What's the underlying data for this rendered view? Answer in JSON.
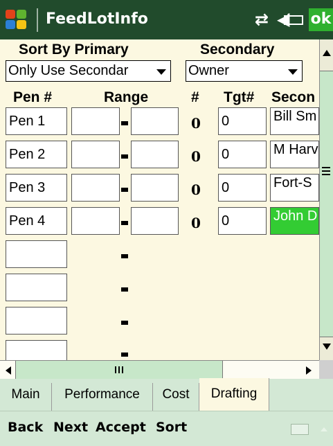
{
  "window": {
    "title": "FeedLotInfo",
    "ok_label": "ok"
  },
  "header": {
    "sort_primary_label": "Sort By Primary",
    "secondary_label": "Secondary"
  },
  "selects": {
    "primary_value": "Only Use Secondar",
    "secondary_value": "Owner"
  },
  "columns": {
    "pen": "Pen #",
    "range": "Range",
    "count": "#",
    "target": "Tgt#",
    "secondary": "Secon"
  },
  "rows": [
    {
      "pen": "Pen 1",
      "count": "0",
      "target": "0",
      "secondary": "Bill Sm"
    },
    {
      "pen": "Pen 2",
      "count": "0",
      "target": "0",
      "secondary": "M Harv"
    },
    {
      "pen": "Pen 3",
      "count": "0",
      "target": "0",
      "secondary": "Fort-S"
    },
    {
      "pen": "Pen 4",
      "count": "0",
      "target": "0",
      "secondary": "John D"
    }
  ],
  "tabs": [
    "Main",
    "Performance",
    "Cost",
    "Drafting"
  ],
  "active_tab": "Drafting",
  "softkeys": [
    "Back",
    "Next",
    "Accept",
    "Sort"
  ],
  "colors": {
    "titlebar": "#214b2c",
    "content_bg": "#fcf8e1",
    "highlight": "#33cc33",
    "tab_bg": "#d3e8d5"
  }
}
